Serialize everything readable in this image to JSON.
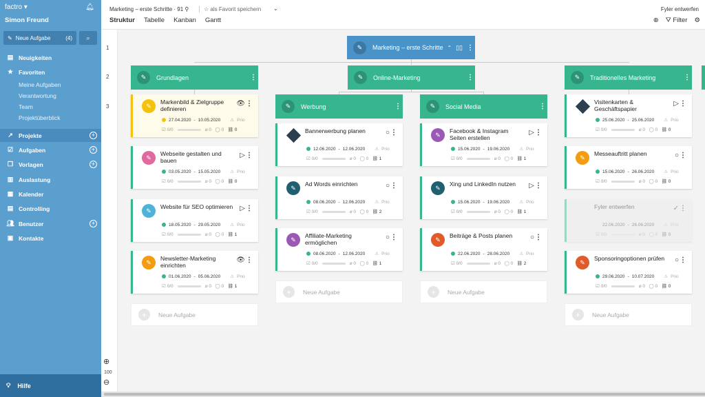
{
  "sidebar": {
    "app": "factro",
    "user": "Simon Freund",
    "new_task": "Neue Aufgabe",
    "new_task_count": "(4)",
    "nav": {
      "neuigkeiten": "Neuigkeiten",
      "favoriten": "Favoriten",
      "projekte": "Projekte",
      "aufgaben": "Aufgaben",
      "vorlagen": "Vorlagen",
      "auslastung": "Auslastung",
      "kalender": "Kalender",
      "controlling": "Controlling",
      "benutzer": "Benutzer",
      "kontakte": "Kontakte"
    },
    "sub": {
      "meine": "Meine Aufgaben",
      "verantwortung": "Verantwortung",
      "team": "Team",
      "ueberblick": "Projektüberblick"
    },
    "help": "Hilfe"
  },
  "header": {
    "title": "Marketing – erste Schritte · 91",
    "fav": "als Favorit speichern",
    "tabs": [
      "Struktur",
      "Tabelle",
      "Kanban",
      "Gantt"
    ],
    "right": "Fyler entwerfen",
    "filter": "Filter"
  },
  "levels": [
    "1",
    "2",
    "3"
  ],
  "zoom": "100",
  "root": {
    "title": "Marketing – erste Schritte"
  },
  "l2": {
    "grundlagen": "Grundlagen",
    "online": "Online-Marketing",
    "trad": "Traditionelles Marketing"
  },
  "l3": {
    "werbung": "Werbung",
    "social": "Social Media"
  },
  "prio": "Prio",
  "new_task": "Neue Aufgabe",
  "cards": {
    "c1": {
      "title": "Markenbild & Zielgruppe definieren",
      "start": "27.04.2020",
      "end": "10.05.2020",
      "s1": "0/0",
      "s2": "0",
      "s3": "0",
      "s4": "0"
    },
    "c2": {
      "title": "Webseite gestalten und bauen",
      "start": "03.05.2020",
      "end": "15.05.2020",
      "s1": "0/0",
      "s2": "0",
      "s3": "0",
      "s4": "0"
    },
    "c3": {
      "title": "Website für SEO optimieren",
      "start": "18.05.2020",
      "end": "29.05.2020",
      "s1": "0/0",
      "s2": "0",
      "s3": "0",
      "s4": "1"
    },
    "c4": {
      "title": "Newsletter-Marketing einrichten",
      "start": "01.06.2020",
      "end": "05.06.2020",
      "s1": "0/0",
      "s2": "0",
      "s3": "0",
      "s4": "1"
    },
    "c5": {
      "title": "Bannerwerbung planen",
      "start": "12.06.2020",
      "end": "12.06.2020",
      "s1": "0/0",
      "s2": "0",
      "s3": "0",
      "s4": "1"
    },
    "c6": {
      "title": "Ad Words einrichten",
      "start": "08.06.2020",
      "end": "12.06.2020",
      "s1": "0/0",
      "s2": "0",
      "s3": "0",
      "s4": "2"
    },
    "c7": {
      "title": "Affiliate-Marketing ermöglichen",
      "start": "08.06.2020",
      "end": "12.06.2020",
      "s1": "0/0",
      "s2": "0",
      "s3": "0",
      "s4": "1"
    },
    "c8": {
      "title": "Facebook & Instagram Seiten erstellen",
      "start": "15.06.2020",
      "end": "19.06.2020",
      "s1": "0/0",
      "s2": "0",
      "s3": "0",
      "s4": "1"
    },
    "c9": {
      "title": "Xing und LinkedIn nutzen",
      "start": "15.06.2020",
      "end": "19.06.2020",
      "s1": "0/0",
      "s2": "0",
      "s3": "0",
      "s4": "1"
    },
    "c10": {
      "title": "Beiträge & Posts planen",
      "start": "22.06.2020",
      "end": "28.06.2020",
      "s1": "0/0",
      "s2": "0",
      "s3": "0",
      "s4": "2"
    },
    "c11": {
      "title": "Visitenkarten & Geschäftspapier",
      "start": "25.06.2020",
      "end": "25.06.2020",
      "s1": "0/0",
      "s2": "0",
      "s3": "0",
      "s4": "0"
    },
    "c12": {
      "title": "Messeauftritt planen",
      "start": "15.06.2020",
      "end": "26.06.2020",
      "s1": "0/0",
      "s2": "0",
      "s3": "0",
      "s4": "0"
    },
    "c13": {
      "title": "Fyler entwerfen",
      "start": "22.06.2020",
      "end": "26.06.2020",
      "s1": "0/0",
      "s2": "0",
      "s3": "0",
      "s4": "0"
    },
    "c14": {
      "title": "Sponsoringoptionen prüfen",
      "start": "29.06.2020",
      "end": "10.07.2020",
      "s1": "0/0",
      "s2": "0",
      "s3": "0",
      "s4": "0"
    }
  },
  "colors": {
    "green": "#36b58f",
    "blue": "#4993c9",
    "yellow": "#f4c20d",
    "pink": "#e06aa0",
    "lightblue": "#4fb3d9",
    "orange": "#f39c12",
    "navy": "#2c3e50",
    "teal": "#1f5f6f",
    "purple": "#9b59b6",
    "red": "#e05a2a"
  }
}
